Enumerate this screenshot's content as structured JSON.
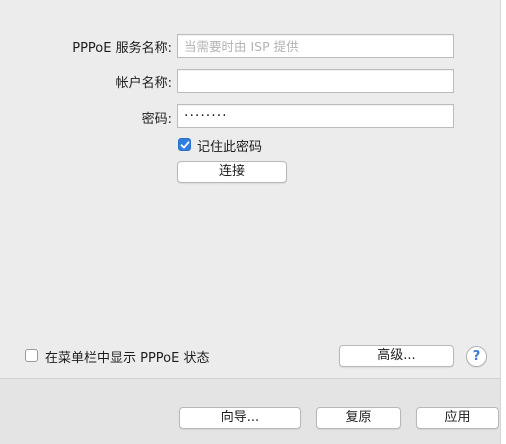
{
  "form": {
    "service_name_label": "PPPoE 服务名称:",
    "service_name_value": "",
    "service_name_placeholder": "当需要时由 ISP 提供",
    "account_label": "帐户名称:",
    "account_value": "",
    "password_label": "密码:",
    "password_value": "········",
    "remember_label": "记住此密码",
    "remember_checked": true,
    "connect_label": "连接"
  },
  "options": {
    "show_menu_label": "在菜单栏中显示 PPPoE 状态",
    "show_menu_checked": false,
    "advanced_label": "高级...",
    "help_label": "?"
  },
  "footer": {
    "assistant_label": "向导...",
    "revert_label": "复原",
    "apply_label": "应用"
  },
  "colors": {
    "accent": "#2f7de1",
    "help_glyph": "#3a7bd5"
  }
}
